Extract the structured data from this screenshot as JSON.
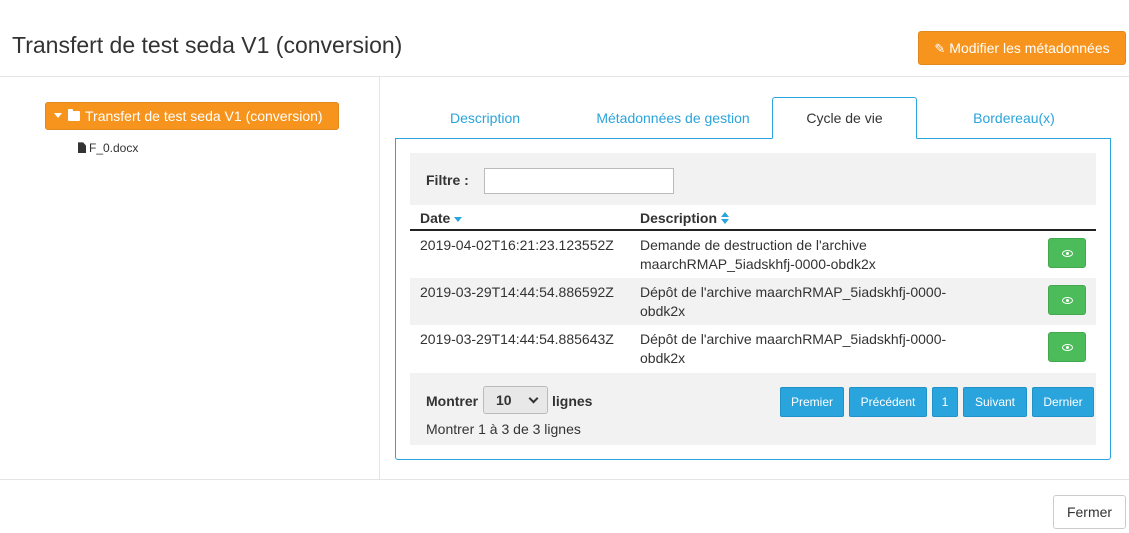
{
  "header": {
    "title": "Transfert de test seda V1 (conversion)",
    "edit_meta_label": "Modifier les métadonnées",
    "edit_icon": "edit-icon"
  },
  "tree": {
    "root_label": "Transfert de test seda V1 (conversion)",
    "files": [
      "F_0.docx"
    ]
  },
  "tabs": [
    {
      "label": "Description",
      "active": false
    },
    {
      "label": "Métadonnées de gestion",
      "active": false
    },
    {
      "label": "Cycle de vie",
      "active": true
    },
    {
      "label": "Bordereau(x)",
      "active": false
    }
  ],
  "filter": {
    "label": "Filtre :",
    "value": ""
  },
  "table": {
    "columns": [
      "Date",
      "Description"
    ],
    "rows": [
      {
        "date": "2019-04-02T16:21:23.123552Z",
        "description": "Demande de destruction de l'archive maarchRMAP_5iadskhfj-0000-obdk2x"
      },
      {
        "date": "2019-03-29T14:44:54.886592Z",
        "description": "Dépôt de l'archive maarchRMAP_5iadskhfj-0000-obdk2x"
      },
      {
        "date": "2019-03-29T14:44:54.885643Z",
        "description": "Dépôt de l'archive maarchRMAP_5iadskhfj-0000-obdk2x"
      }
    ]
  },
  "paging": {
    "show_label": "Montrer",
    "page_length": "10",
    "lines_label": "lignes",
    "info": "Montrer 1 à 3 de 3 lignes",
    "buttons": [
      "Premier",
      "Précédent",
      "1",
      "Suivant",
      "Dernier"
    ]
  },
  "footer": {
    "close_label": "Fermer"
  },
  "colors": {
    "accent": "#f7941d",
    "link": "#2aa4dc",
    "success": "#4cbb59"
  }
}
